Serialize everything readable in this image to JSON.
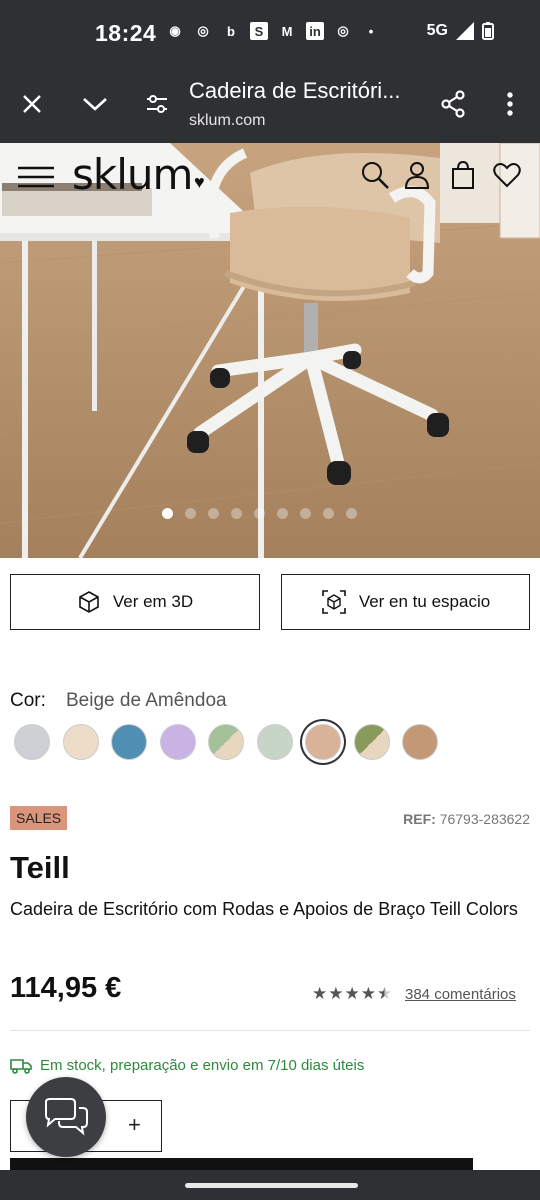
{
  "status": {
    "time": "18:24",
    "icons": [
      "discord-icon",
      "chrome-icon",
      "bing-icon",
      "s-icon",
      "gmail-icon",
      "linkedin-icon",
      "chrome-icon",
      "dot-icon"
    ],
    "network": "5G",
    "battery_icon": "battery-icon"
  },
  "browser": {
    "title": "Cadeira de Escritóri...",
    "url": "sklum.com"
  },
  "site": {
    "logo": "sklum",
    "icons": [
      "search-icon",
      "user-icon",
      "cart-icon",
      "heart-icon"
    ]
  },
  "gallery": {
    "total_images": 9,
    "active_index": 0
  },
  "actions": {
    "view_3d": "Ver em 3D",
    "view_space": "Ver en tu espacio"
  },
  "color": {
    "label": "Cor:",
    "value": "Beige de Amêndoa",
    "swatches": [
      "#cfcfd6",
      "#ecdcc8",
      "#4f8fb3",
      "#c9b2e4",
      "#a5c19a",
      "#c7d5c8",
      "#d9b397",
      "#8a9a5a",
      "#c29877"
    ],
    "selected_index": 6
  },
  "product": {
    "badge": "SALES",
    "ref_label": "REF:",
    "ref_value": "76793-283622",
    "name": "Teill",
    "description": "Cadeira de Escritório com Rodas e Apoios de Braço Teill Colors",
    "price": "114,95 €",
    "rating": 4.5,
    "reviews": "384 comentários",
    "stock": "Em stock, preparação e envio em 7/10 dias úteis"
  },
  "colors": {
    "chrome_bg": "#2f3033",
    "badge_bg": "#d9967c",
    "stock_green": "#2d8a3c"
  }
}
